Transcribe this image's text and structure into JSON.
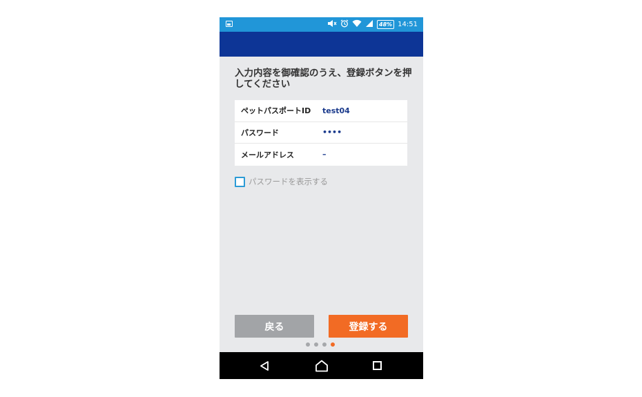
{
  "status_bar": {
    "battery_level": "48%",
    "time": "14:51",
    "icons": [
      "image-notification-icon",
      "mute-icon",
      "alarm-icon",
      "wifi-icon",
      "signal-icon",
      "battery-icon"
    ]
  },
  "colors": {
    "status_bar": "#2196d8",
    "app_bar": "#0d3596",
    "background": "#e8e9eb",
    "accent": "#f26b24",
    "value_text": "#1a3a8c",
    "checkbox_border": "#2b9bd6"
  },
  "heading": "入力内容を御確認のうえ、登録ボタンを押してください",
  "details": {
    "rows": [
      {
        "label": "ペットパスポートID",
        "value": "test04"
      },
      {
        "label": "パスワード",
        "value": "••••"
      },
      {
        "label": "メールアドレス",
        "value": "–"
      }
    ]
  },
  "show_password": {
    "label": "パスワードを表示する",
    "checked": false
  },
  "buttons": {
    "back_label": "戻る",
    "register_label": "登録する"
  },
  "pager": {
    "total": 4,
    "current": 4
  },
  "nav_bar": {
    "icons": [
      "back-icon",
      "home-icon",
      "recent-apps-icon"
    ]
  }
}
